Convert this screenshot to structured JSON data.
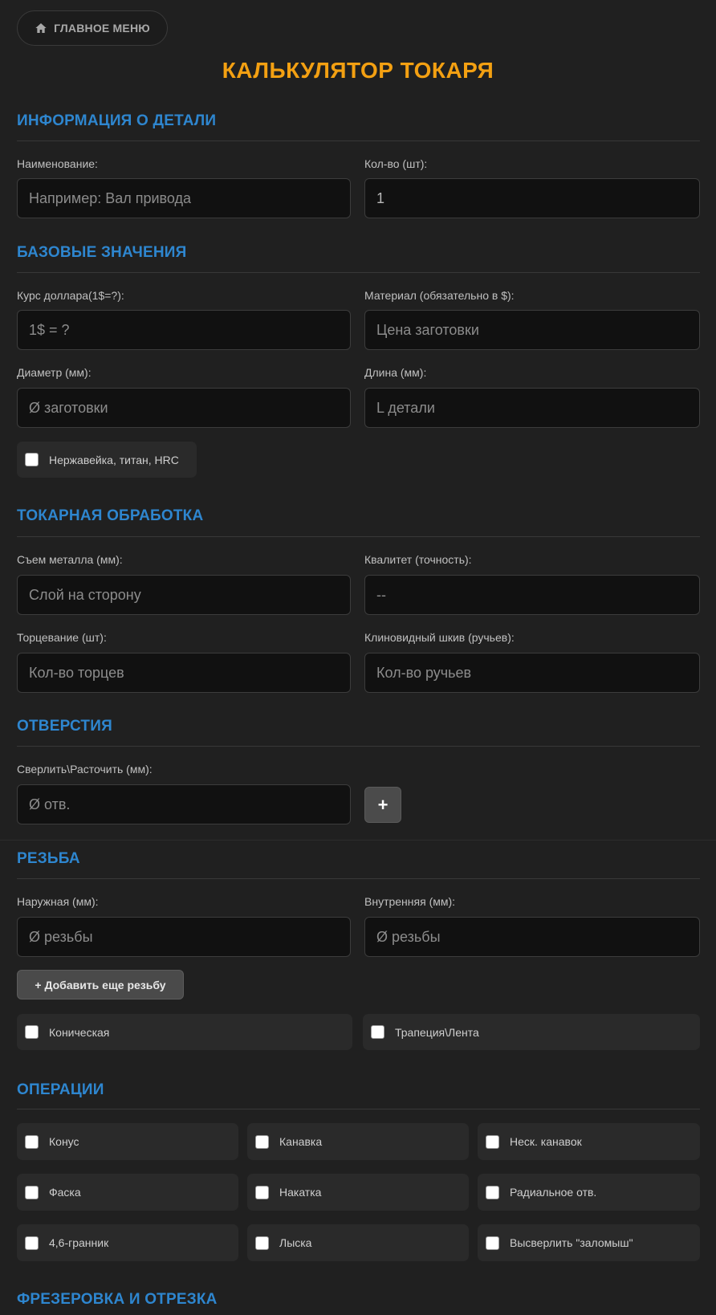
{
  "nav": {
    "main_menu": "ГЛАВНОЕ МЕНЮ"
  },
  "title": "КАЛЬКУЛЯТОР ТОКАРЯ",
  "sections": {
    "info": "ИНФОРМАЦИЯ О ДЕТАЛИ",
    "base": "БАЗОВЫЕ ЗНАЧЕНИЯ",
    "turning": "ТОКАРНАЯ ОБРАБОТКА",
    "holes": "ОТВЕРСТИЯ",
    "thread": "РЕЗЬБА",
    "operations": "ОПЕРАЦИИ",
    "milling": "ФРЕЗЕРОВКА И ОТРЕЗКА"
  },
  "info": {
    "name_label": "Наименование:",
    "name_placeholder": "Например: Вал привода",
    "qty_label": "Кол-во (шт):",
    "qty_value": "1"
  },
  "base": {
    "rate_label": "Курс доллара(1$=?):",
    "rate_placeholder": "1$ = ?",
    "material_label": "Материал (обязательно в $):",
    "material_placeholder": "Цена заготовки",
    "diameter_label": "Диаметр (мм):",
    "diameter_placeholder": "Ø заготовки",
    "length_label": "Длина (мм):",
    "length_placeholder": "L детали",
    "hard_material": "Нержавейка, титан, HRC"
  },
  "turning": {
    "removal_label": "Съем металла (мм):",
    "removal_placeholder": "Слой на сторону",
    "quality_label": "Квалитет (точность):",
    "quality_value": "--",
    "facing_label": "Торцевание (шт):",
    "facing_placeholder": "Кол-во торцев",
    "pulley_label": "Клиновидный шкив (ручьев):",
    "pulley_placeholder": "Кол-во ручьев"
  },
  "holes": {
    "drill_label": "Сверлить\\Расточить (мм):",
    "drill_placeholder": "Ø отв.",
    "add_label": "+"
  },
  "thread": {
    "outer_label": "Наружная (мм):",
    "outer_placeholder": "Ø резьбы",
    "inner_label": "Внутренняя (мм):",
    "inner_placeholder": "Ø резьбы",
    "add_more": "+ Добавить еще резьбу",
    "conical": "Коническая",
    "trapezoid": "Трапеция\\Лента"
  },
  "operations": {
    "items": [
      "Конус",
      "Канавка",
      "Неск. канавок",
      "Фаска",
      "Накатка",
      "Радиальное отв.",
      "4,6-гранник",
      "Лыска",
      "Высверлить \"заломыш\""
    ]
  }
}
